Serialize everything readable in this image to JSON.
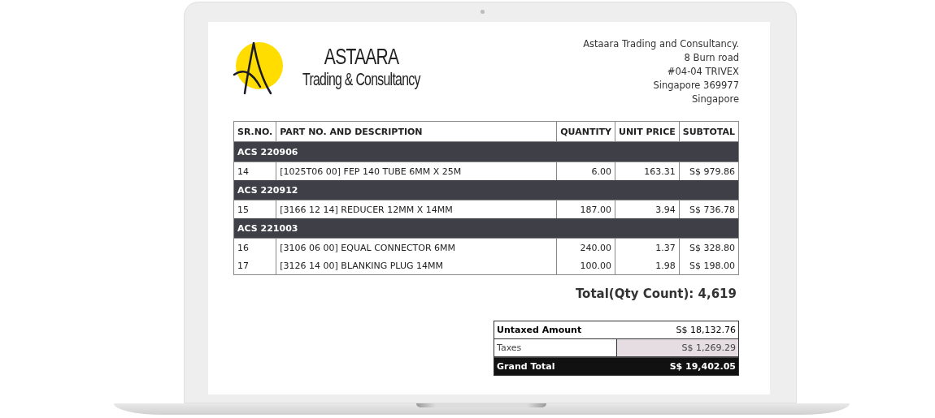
{
  "logo": {
    "name": "ASTAARA",
    "tagline": "Trading & Consultancy"
  },
  "address": [
    "Astaara Trading and Consultancy.",
    "8 Burn road",
    "#04-04 TRIVEX",
    "Singapore 369977",
    "Singapore"
  ],
  "table": {
    "columns": [
      "SR.NO.",
      "PART NO. AND DESCRIPTION",
      "QUANTITY",
      "UNIT PRICE",
      "SUBTOTAL"
    ],
    "groups": [
      {
        "title": "ACS 220906",
        "rows": [
          [
            "14",
            "[1025T06 00] FEP 140 TUBE 6MM X 25M",
            "6.00",
            "163.31",
            "S$ 979.86"
          ]
        ]
      },
      {
        "title": "ACS 220912",
        "rows": [
          [
            "15",
            "[3166 12 14] REDUCER 12MM X 14MM",
            "187.00",
            "3.94",
            "S$ 736.78"
          ]
        ]
      },
      {
        "title": "ACS 221003",
        "rows": [
          [
            "16",
            "[3106 06 00] EQUAL CONNECTOR 6MM",
            "240.00",
            "1.37",
            "S$ 328.80"
          ],
          [
            "17",
            "[3126 14 00] BLANKING PLUG 14MM",
            "100.00",
            "1.98",
            "S$ 198.00"
          ]
        ]
      }
    ]
  },
  "total_qty": "Total(Qty Count): 4,619",
  "summary": [
    {
      "kind": "subtotal",
      "label": "Untaxed Amount",
      "value": "S$ 18,132.76"
    },
    {
      "kind": "tax",
      "label": "Taxes",
      "value": "S$ 1,269.29"
    },
    {
      "kind": "grand",
      "label": "Grand Total",
      "value": "S$ 19,402.05"
    }
  ]
}
